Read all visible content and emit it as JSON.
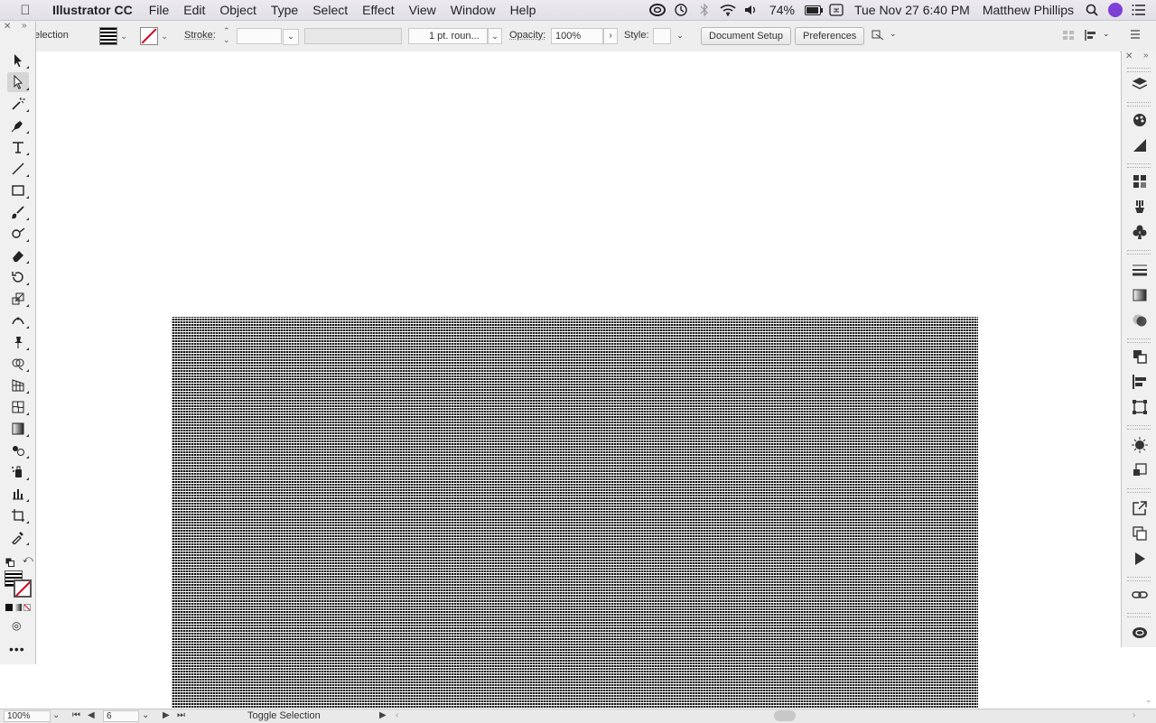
{
  "menubar": {
    "app_name": "Illustrator CC",
    "items": [
      "File",
      "Edit",
      "Object",
      "Type",
      "Select",
      "Effect",
      "View",
      "Window",
      "Help"
    ],
    "battery": "74%",
    "battery_level": 0.74,
    "datetime": "Tue Nov 27  6:40 PM",
    "user": "Matthew Phillips"
  },
  "controlbar": {
    "selection_label": "election",
    "stroke_label": "Stroke:",
    "stroke_weight_value": "",
    "brush_value": "",
    "profile_value": "1 pt. roun...",
    "opacity_label": "Opacity:",
    "opacity_value": "100%",
    "style_label": "Style:",
    "document_setup": "Document Setup",
    "preferences": "Preferences"
  },
  "statusbar": {
    "zoom": "100%",
    "artboard": "6",
    "status_text": "Toggle Selection"
  },
  "colors": {
    "accent_red": "#d0021b",
    "cc_purple": "#7d3fd6"
  }
}
